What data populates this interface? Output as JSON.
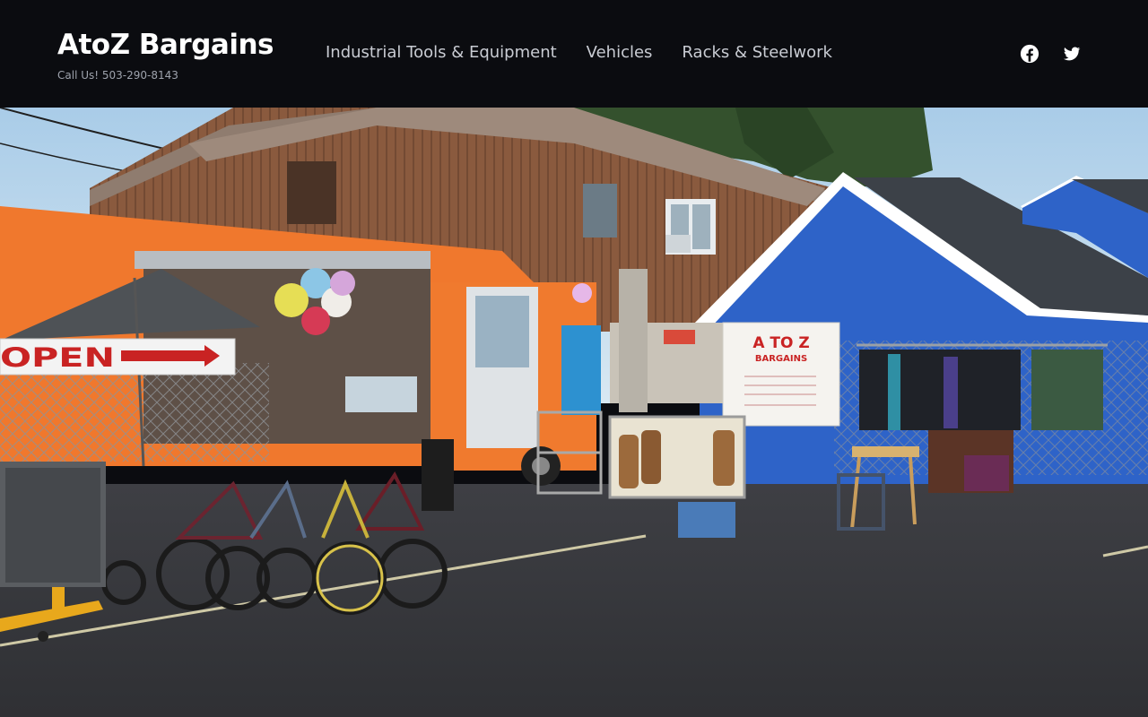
{
  "site": {
    "title": "AtoZ Bargains",
    "tagline": "Call Us! 503-290-8143"
  },
  "nav": {
    "items": [
      {
        "label": "Industrial Tools & Equipment"
      },
      {
        "label": "Vehicles"
      },
      {
        "label": "Racks & Steelwork"
      }
    ]
  },
  "social": {
    "facebook_icon": "facebook-icon",
    "twitter_icon": "twitter-icon"
  },
  "hero": {
    "open_sign_text": "OPEN",
    "banner": {
      "line1": "A TO Z",
      "line2": "BARGAINS"
    }
  },
  "colors": {
    "header_bg": "#0b0c10",
    "title": "#ffffff",
    "nav_text": "#c9ccd3",
    "tagline": "#9ea3ad",
    "accent_dot": "#1e9bd7"
  }
}
